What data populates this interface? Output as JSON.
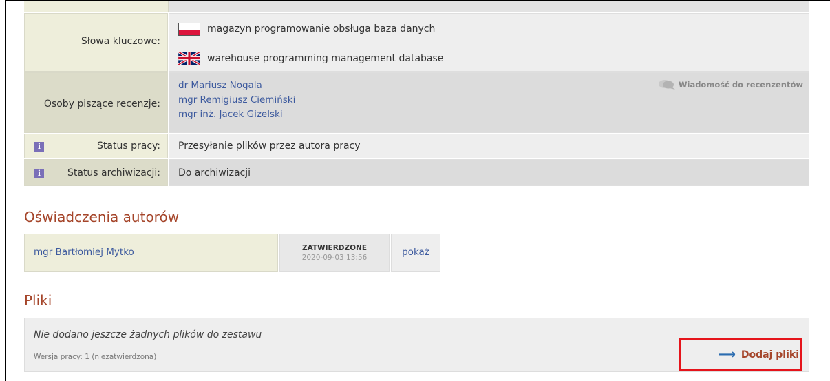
{
  "keywords": {
    "label": "Słowa kluczowe:",
    "pl": "magazyn programowanie obsługa baza danych",
    "en": "warehouse programming management database"
  },
  "reviewers": {
    "label": "Osoby piszące recenzje:",
    "people": [
      "dr Mariusz Nogala",
      "mgr Remigiusz Ciemiński",
      "mgr inż. Jacek Gizelski"
    ],
    "message_link": "Wiadomość do recenzentów"
  },
  "work_status": {
    "icon_letter": "i",
    "label": "Status pracy:",
    "value": "Przesyłanie plików przez autora pracy"
  },
  "archive_status": {
    "icon_letter": "i",
    "label": "Status archiwizacji:",
    "value": "Do archiwizacji"
  },
  "declarations": {
    "title": "Oświadczenia autorów",
    "author": "mgr Bartłomiej Mytko",
    "status": "ZATWIERDZONE",
    "date": "2020-09-03 13:56",
    "show_link": "pokaż"
  },
  "files": {
    "title": "Pliki",
    "empty_message": "Nie dodano jeszcze żadnych plików do zestawu",
    "version": "Wersja pracy: 1 (niezatwierdzona)",
    "add_button": "Dodaj pliki",
    "add_arrow": "⟶"
  },
  "colors": {
    "section_title": "#a5452a",
    "link": "#3d5a9e",
    "highlight_box": "#e5141b"
  }
}
